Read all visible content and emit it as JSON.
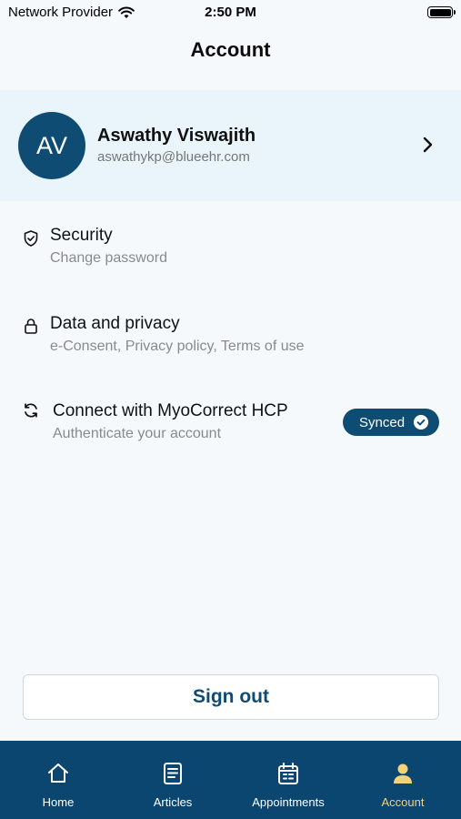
{
  "status": {
    "carrier": "Network Provider",
    "time": "2:50 PM"
  },
  "header": {
    "title": "Account"
  },
  "profile": {
    "initials": "AV",
    "name": "Aswathy Viswajith",
    "email": "aswathykp@blueehr.com"
  },
  "menu": [
    {
      "title": "Security",
      "subtitle": "Change password",
      "icon": "shield-check-icon"
    },
    {
      "title": "Data and privacy",
      "subtitle": "e-Consent, Privacy policy, Terms of use",
      "icon": "lock-icon"
    },
    {
      "title": "Connect with MyoCorrect HCP",
      "subtitle": "Authenticate your account",
      "icon": "sync-icon",
      "badge": "Synced"
    }
  ],
  "signout": {
    "label": "Sign out"
  },
  "tabs": [
    {
      "label": "Home",
      "icon": "home-icon",
      "active": false
    },
    {
      "label": "Articles",
      "icon": "article-icon",
      "active": false
    },
    {
      "label": "Appointments",
      "icon": "calendar-icon",
      "active": false
    },
    {
      "label": "Account",
      "icon": "person-icon",
      "active": true
    }
  ],
  "colors": {
    "primary": "#0f4c73",
    "tabbar": "#0b4670",
    "active_tab": "#f3d27a",
    "profile_bg": "#e9f4fb",
    "page_bg": "#f5f9fc"
  }
}
